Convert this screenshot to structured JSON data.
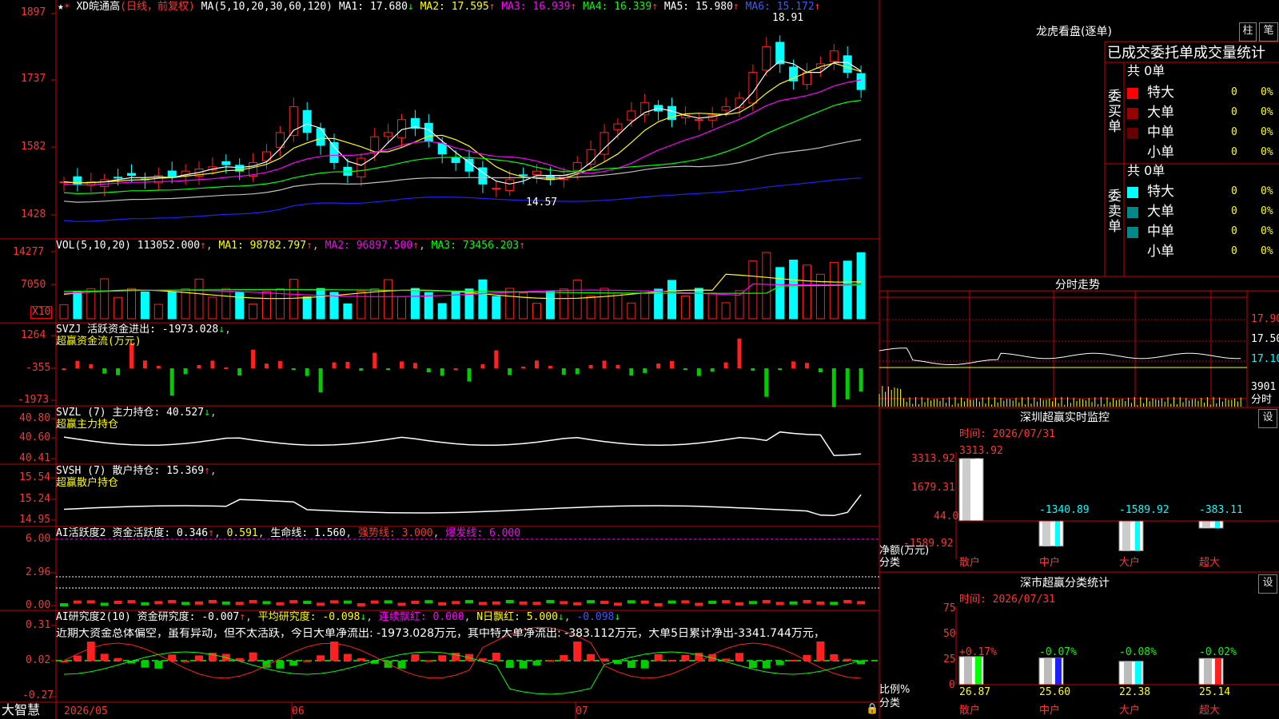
{
  "colors": {
    "up": "#ff2020",
    "down": "#00ffff",
    "grid": "#cc0000",
    "ma1": "#ffffff",
    "ma2": "#ffff00",
    "ma3": "#ff00ff",
    "ma4": "#00ff00",
    "ma5": "#c0c0c0",
    "ma6": "#2020ff"
  },
  "header": {
    "stock": "XD皖通高",
    "mode": "(日线，前复权)",
    "ma_def": "MA(5,10,20,30,60,120)",
    "ma1": "MA1: 17.680",
    "ma2": "MA2: 17.595",
    "ma3": "MA3: 16.939",
    "ma4": "MA4: 16.339",
    "ma5": "MA5: 15.980",
    "ma6": "MA6: 15.172",
    "up": "↑",
    "down": "↓"
  },
  "price_axis": [
    "1897",
    "1737",
    "1582",
    "1428"
  ],
  "price_marks": {
    "high": "18.91",
    "low": "14.57"
  },
  "vol": {
    "def": "VOL(5,10,20)",
    "value": "113052.000",
    "ma1": "MA1: 98782.797",
    "ma2": "MA2: 96897.500",
    "ma3": "MA3: 73456.203",
    "axis": [
      "14277",
      "7050"
    ],
    "unit": "X10"
  },
  "svzj": {
    "def": "SVZJ",
    "label": "活跃资金进出: -1973.028",
    "sub": "超赢资金流(万元)",
    "axis": [
      "1264",
      "-355",
      "-1973"
    ]
  },
  "svzl": {
    "def": "SVZL (7)",
    "label": "主力持仓: 40.527",
    "sub": "超赢主力持仓",
    "axis": [
      "40.80",
      "40.60",
      "40.41"
    ]
  },
  "svsh": {
    "def": "SVSH (7)",
    "label": "散户持仓: 15.369",
    "sub": "超赢散户持仓",
    "axis": [
      "15.54",
      "15.24",
      "14.95"
    ]
  },
  "ai1": {
    "def": "AI活跃度2",
    "l1": "资金活跃度: 0.346",
    "l2": "0.591",
    "l3": "生命线: 1.560",
    "l4": "强势线: 3.000",
    "l5": "爆发线: 6.000",
    "axis": [
      "6.00",
      "2.96",
      "0.00"
    ]
  },
  "ai2": {
    "def": "AI研究度2(10)",
    "l1": "资金研究度: -0.007",
    "l2": "平均研究度: -0.098",
    "l3": "连续飘红: 0.000",
    "l4": "N日飘红: 5.000",
    "l5": "-0.098",
    "axis": [
      "0.31",
      "0.02",
      "-0.27"
    ],
    "text": "近期大资金总体偏空，虽有异动，但不太活跃，今日大单净流出: -1973.028万元，其中特大单净流出: -383.112万元，大单5日累计净出-3341.744万元，"
  },
  "xaxis": {
    "brand": "大智慧",
    "months": [
      "2026/05",
      "06",
      "07"
    ]
  },
  "lhb": {
    "title": "龙虎看盘(逐单)",
    "btn1": "柱",
    "btn2": "笔",
    "header": "已成交委托单成交量统计",
    "buy_label": "委买单",
    "sell_label": "委卖单",
    "buy_total": "共 0单",
    "sell_total": "共 0单",
    "buy_rows": [
      {
        "name": "特大",
        "val": "0",
        "pct": "0%",
        "color": "#ff0000"
      },
      {
        "name": "大单",
        "val": "0",
        "pct": "0%",
        "color": "#990000"
      },
      {
        "name": "中单",
        "val": "0",
        "pct": "0%",
        "color": "#660000"
      },
      {
        "name": "小单",
        "val": "0",
        "pct": "0%",
        "color": ""
      }
    ],
    "sell_rows": [
      {
        "name": "特大",
        "val": "0",
        "pct": "0%",
        "color": "#00ffff"
      },
      {
        "name": "大单",
        "val": "0",
        "pct": "0%",
        "color": "#008888"
      },
      {
        "name": "中单",
        "val": "0",
        "pct": "0%",
        "color": "#008888"
      },
      {
        "name": "小单",
        "val": "0",
        "pct": "0%",
        "color": ""
      }
    ]
  },
  "fenshi": {
    "title": "分时走势",
    "axis": [
      "17.90",
      "17.50",
      "17.10"
    ],
    "vol": "3901",
    "unit": "分时"
  },
  "monitor": {
    "title": "深圳超赢实时监控",
    "btn": "设",
    "time": "时间: 2026/07/31",
    "top": "3313.92",
    "axis": [
      "3313.92",
      "1679.31",
      "44.0",
      "-1589.92"
    ],
    "ylabel": "净额(万元)",
    "xlabel": "分类",
    "cats": [
      {
        "name": "散户",
        "val": 3313.92,
        "label": "3313.92"
      },
      {
        "name": "中户",
        "val": -1340.89,
        "label": "-1340.89"
      },
      {
        "name": "大户",
        "val": -1589.92,
        "label": "-1589.92"
      },
      {
        "name": "超大",
        "val": -383.11,
        "label": "-383.11"
      }
    ]
  },
  "stats": {
    "title": "深市超赢分类统计",
    "btn": "设",
    "time": "时间: 2026/07/31",
    "axis": [
      "75",
      "50",
      "25",
      "0"
    ],
    "ylabel": "比例%",
    "xlabel": "分类",
    "cats": [
      {
        "name": "散户",
        "val": 26.87,
        "label": "26.87",
        "chg": "+0.17%"
      },
      {
        "name": "中户",
        "val": 25.6,
        "label": "25.60",
        "chg": "-0.07%"
      },
      {
        "name": "大户",
        "val": 22.38,
        "label": "22.38",
        "chg": "-0.08%"
      },
      {
        "name": "超大",
        "val": 25.14,
        "label": "25.14",
        "chg": "-0.02%"
      }
    ]
  }
}
